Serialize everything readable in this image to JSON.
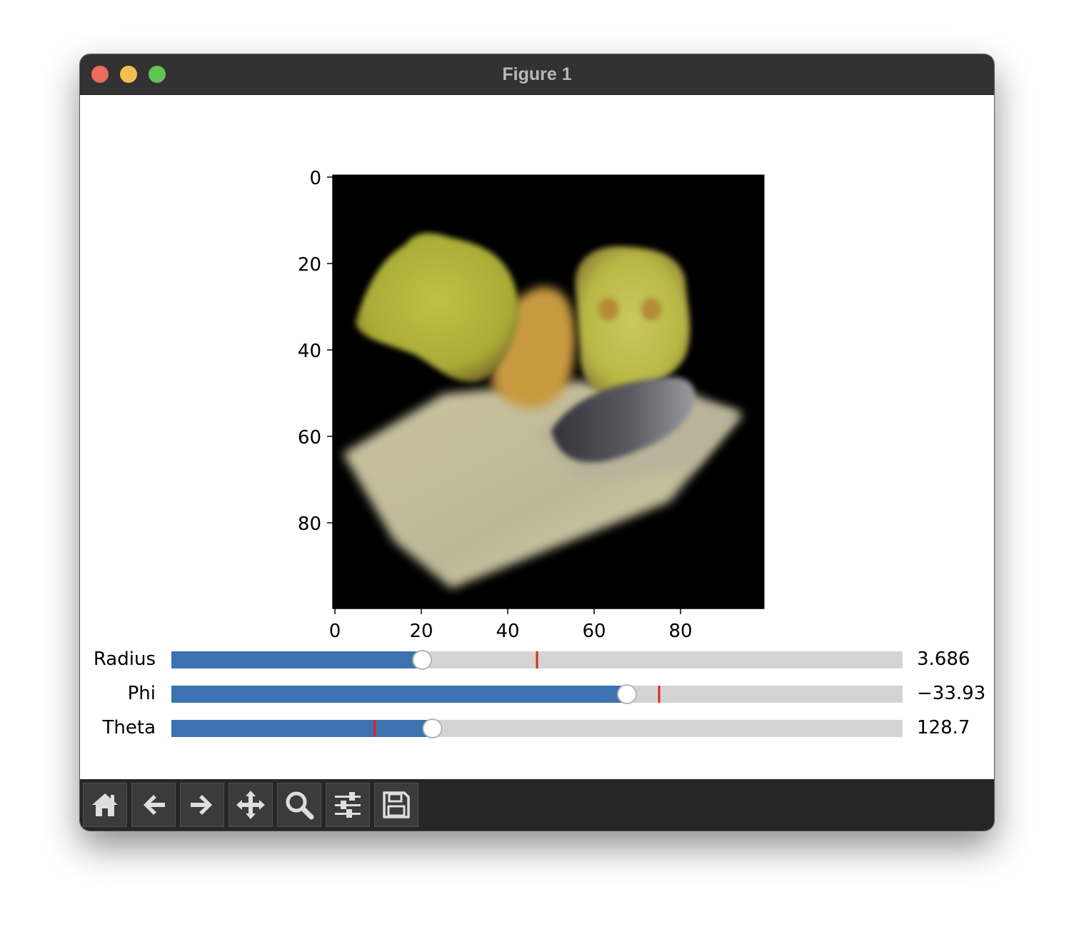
{
  "window": {
    "title": "Figure 1"
  },
  "chart_data": {
    "type": "image",
    "xticks": [
      "0",
      "20",
      "40",
      "60",
      "80"
    ],
    "yticks": [
      "0",
      "20",
      "40",
      "60",
      "80"
    ],
    "xlim": [
      -0.5,
      99.5
    ],
    "ylim": [
      99.5,
      -0.5
    ]
  },
  "sliders": [
    {
      "label": "Radius",
      "value_text": "3.686",
      "fraction": 0.343,
      "initial_fraction": 0.5,
      "fill_color": "#3d72b0",
      "marker_color": "#e0271e"
    },
    {
      "label": "Phi",
      "value_text": "−33.93",
      "fraction": 0.623,
      "initial_fraction": 0.667,
      "fill_color": "#3d72b0",
      "marker_color": "#e0271e"
    },
    {
      "label": "Theta",
      "value_text": "128.7",
      "fraction": 0.357,
      "initial_fraction": 0.278,
      "fill_color": "#3d72b0",
      "marker_color": "#e0271e"
    }
  ],
  "toolbar": {
    "buttons": [
      {
        "name": "home-button",
        "icon": "home-icon"
      },
      {
        "name": "back-button",
        "icon": "arrow-left-icon"
      },
      {
        "name": "forward-button",
        "icon": "arrow-right-icon"
      },
      {
        "name": "pan-button",
        "icon": "move-icon"
      },
      {
        "name": "zoom-button",
        "icon": "magnifier-icon"
      },
      {
        "name": "configure-subplots-button",
        "icon": "sliders-icon"
      },
      {
        "name": "save-button",
        "icon": "floppy-icon"
      }
    ]
  }
}
